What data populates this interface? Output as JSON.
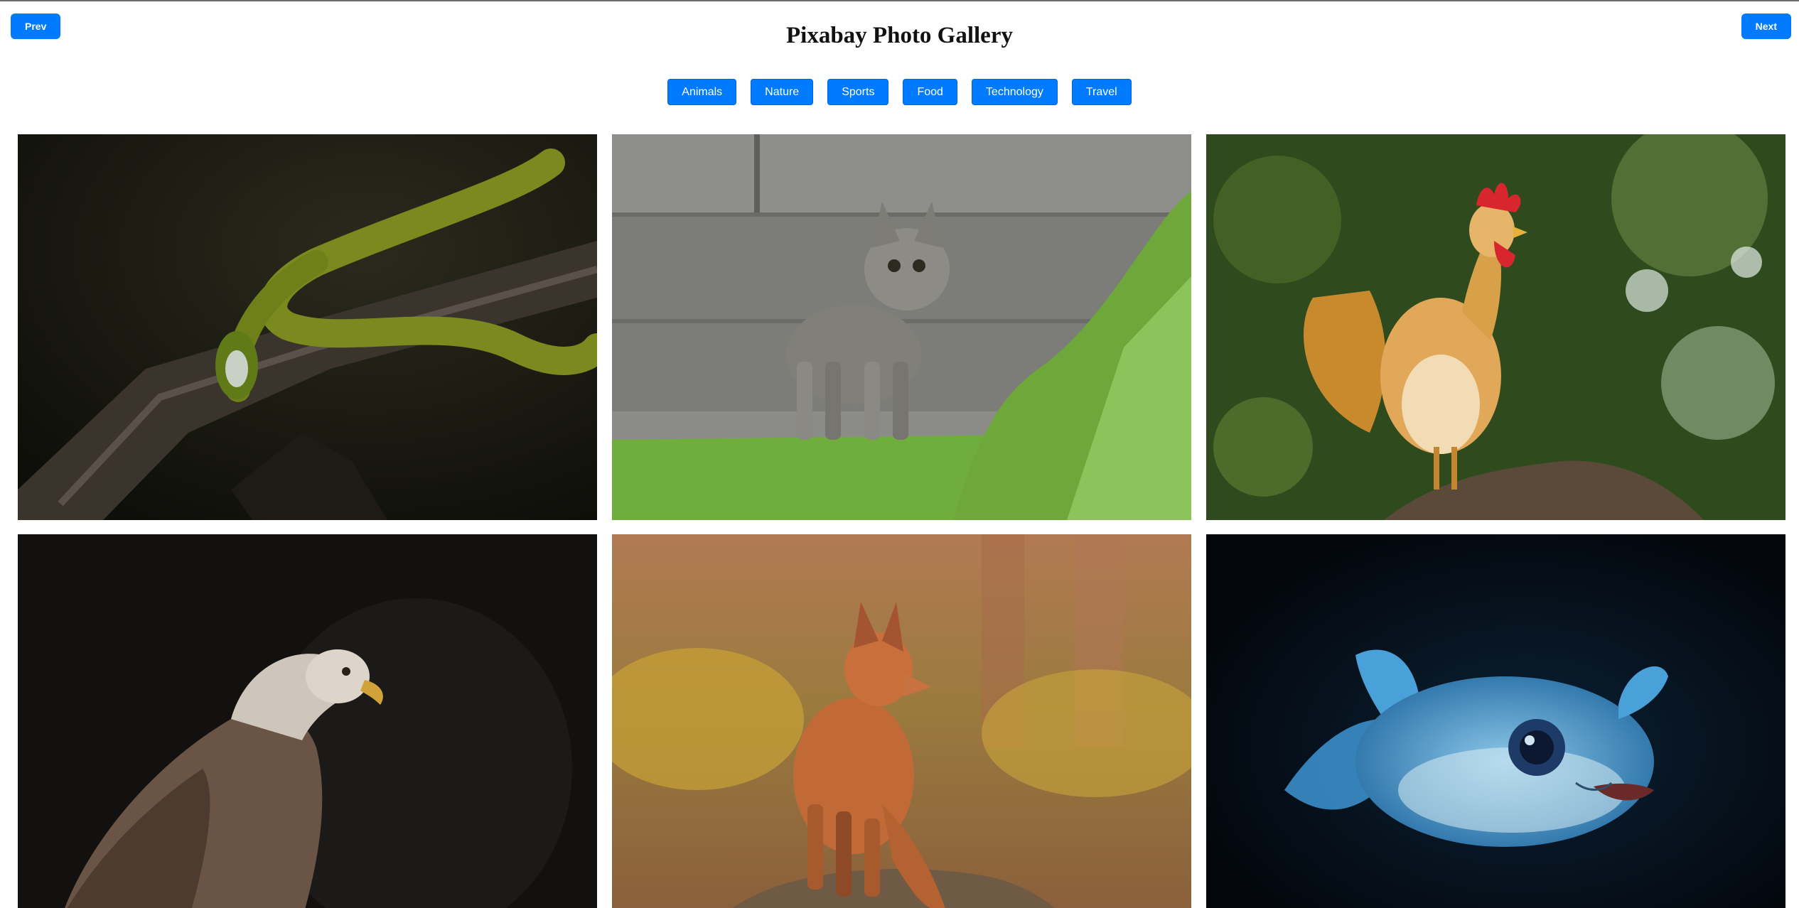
{
  "header": {
    "title": "Pixabay Photo Gallery",
    "prev_label": "Prev",
    "next_label": "Next"
  },
  "categories": [
    "Animals",
    "Nature",
    "Sports",
    "Food",
    "Technology",
    "Travel"
  ],
  "colors": {
    "accent": "#007bff",
    "button_text": "#ffffff",
    "background": "#ffffff"
  },
  "photos": [
    {
      "subject": "green snake on branch",
      "icon": "snake-photo"
    },
    {
      "subject": "tabby kitten on path",
      "icon": "kitten-photo"
    },
    {
      "subject": "rooster on branch",
      "icon": "rooster-photo"
    },
    {
      "subject": "eagle in shadow",
      "icon": "eagle-photo"
    },
    {
      "subject": "red fox in forest",
      "icon": "fox-photo"
    },
    {
      "subject": "pufferfish underwater",
      "icon": "pufferfish-photo"
    }
  ]
}
